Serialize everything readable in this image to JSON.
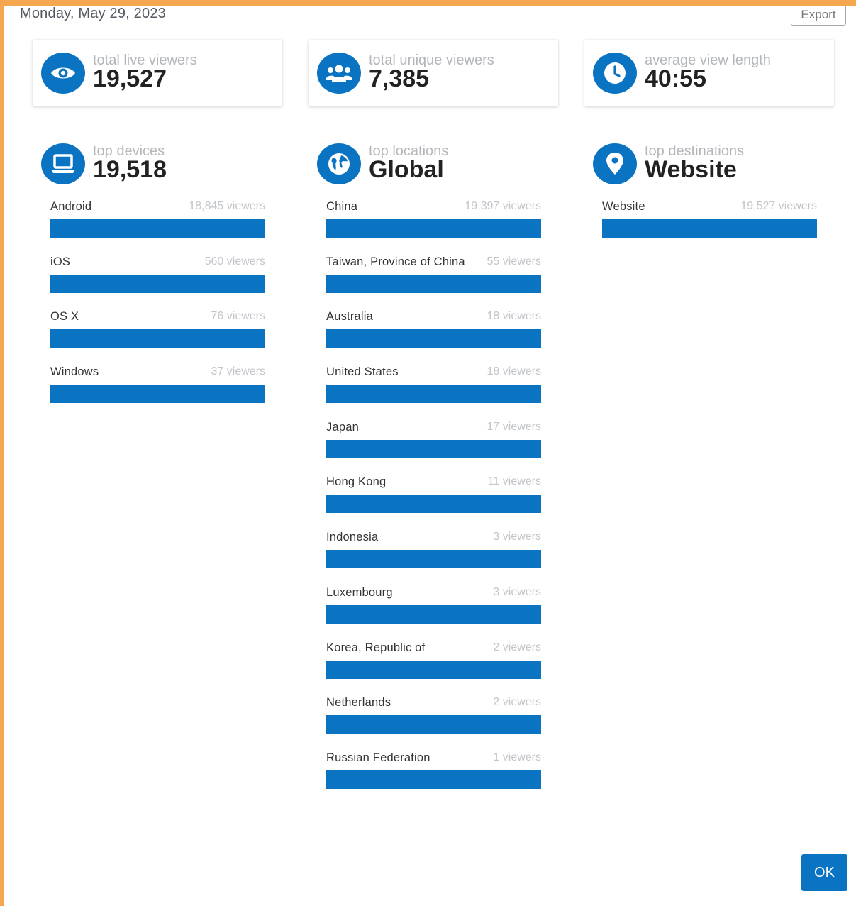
{
  "header": {
    "date": "Monday, May 29, 2023",
    "export_label": "Export"
  },
  "stats": {
    "live": {
      "label": "total live viewers",
      "value": "19,527",
      "icon": "eye-icon"
    },
    "unique": {
      "label": "total unique viewers",
      "value": "7,385",
      "icon": "users-icon"
    },
    "length": {
      "label": "average view length",
      "value": "40:55",
      "icon": "clock-icon"
    }
  },
  "devices": {
    "label": "top devices",
    "value": "19,518",
    "icon": "laptop-icon",
    "items": [
      {
        "name": "Android",
        "count": "18,845 viewers",
        "fill": 1.0
      },
      {
        "name": "iOS",
        "count": "560 viewers",
        "fill": 1.0
      },
      {
        "name": "OS X",
        "count": "76 viewers",
        "fill": 1.0
      },
      {
        "name": "Windows",
        "count": "37 viewers",
        "fill": 1.0
      }
    ]
  },
  "locations": {
    "label": "top locations",
    "value": "Global",
    "icon": "globe-icon",
    "items": [
      {
        "name": "China",
        "count": "19,397 viewers",
        "fill": 1.0
      },
      {
        "name": "Taiwan, Province of China",
        "count": "55 viewers",
        "fill": 1.0
      },
      {
        "name": "Australia",
        "count": "18 viewers",
        "fill": 1.0
      },
      {
        "name": "United States",
        "count": "18 viewers",
        "fill": 1.0
      },
      {
        "name": "Japan",
        "count": "17 viewers",
        "fill": 1.0
      },
      {
        "name": "Hong Kong",
        "count": "11 viewers",
        "fill": 1.0
      },
      {
        "name": "Indonesia",
        "count": "3 viewers",
        "fill": 1.0
      },
      {
        "name": "Luxembourg",
        "count": "3 viewers",
        "fill": 1.0
      },
      {
        "name": "Korea, Republic of",
        "count": "2 viewers",
        "fill": 1.0
      },
      {
        "name": "Netherlands",
        "count": "2 viewers",
        "fill": 1.0
      },
      {
        "name": "Russian Federation",
        "count": "1 viewers",
        "fill": 1.0
      }
    ]
  },
  "destinations": {
    "label": "top destinations",
    "value": "Website",
    "icon": "map-pin-icon",
    "items": [
      {
        "name": "Website",
        "count": "19,527 viewers",
        "fill": 1.0
      }
    ]
  },
  "footer": {
    "ok_label": "OK"
  },
  "colors": {
    "accent": "#0a74c2",
    "muted_text": "#b3b6ba",
    "backdrop": "#f4a74e"
  }
}
